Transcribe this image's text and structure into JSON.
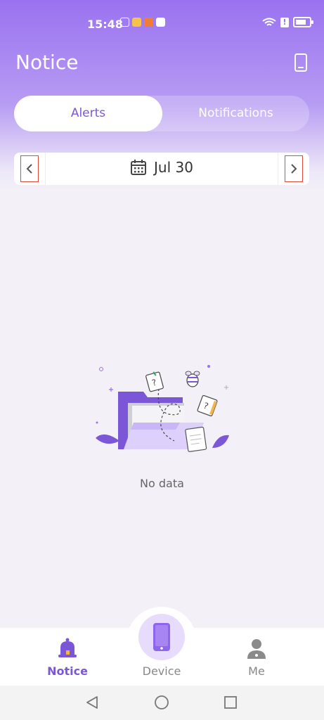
{
  "status_bar": {
    "time": "15:48",
    "icons": [
      "app-grid-icon",
      "weibo-icon",
      "video-app-icon",
      "message-app-icon",
      "wifi-icon",
      "alert-icon",
      "battery-icon"
    ]
  },
  "header": {
    "title": "Notice",
    "device_icon": "phone-icon"
  },
  "tabs": [
    {
      "label": "Alerts",
      "active": true
    },
    {
      "label": "Notifications",
      "active": false
    }
  ],
  "date_nav": {
    "date": "Jul 30",
    "prev_icon": "chevron-left-icon",
    "next_icon": "chevron-right-icon"
  },
  "empty_state": {
    "text": "No data",
    "illustration": "empty-folder-icon"
  },
  "bottom_nav": [
    {
      "label": "Notice",
      "icon": "bell-icon",
      "active": true
    },
    {
      "label": "Device",
      "icon": "phone-icon",
      "active": false
    },
    {
      "label": "Me",
      "icon": "person-icon",
      "active": false
    }
  ],
  "system_nav": [
    "back-icon",
    "home-icon",
    "recents-icon"
  ],
  "colors": {
    "accent": "#7b57d8",
    "header_top": "#9a72f0",
    "background": "#f3f0f8",
    "highlight_box": "#e04a3a"
  }
}
